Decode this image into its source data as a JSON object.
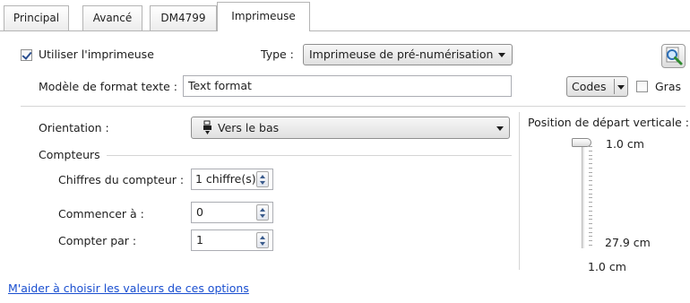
{
  "tabs": [
    {
      "label": "Principal",
      "active": false
    },
    {
      "label": "Avancé",
      "active": false
    },
    {
      "label": "DM4799",
      "active": false
    },
    {
      "label": "Imprimeuse",
      "active": true
    }
  ],
  "imprinter": {
    "use_label": "Utiliser l'imprimeuse",
    "use_checked": true,
    "type_label": "Type :",
    "type_value": "Imprimeuse de pré-numérisation"
  },
  "format": {
    "label": "Modèle de format texte :",
    "value": "Text format",
    "codes_label": "Codes",
    "bold_label": "Gras",
    "bold_checked": false
  },
  "orientation": {
    "label": "Orientation :",
    "value": "Vers le bas"
  },
  "counters": {
    "group_label": "Compteurs",
    "digits_label": "Chiffres du compteur :",
    "digits_value": "1 chiffre(s)",
    "start_label": "Commencer à :",
    "start_value": "0",
    "step_label": "Compter par :",
    "step_value": "1"
  },
  "vertical_position": {
    "label": "Position de départ verticale :",
    "top_value": "1.0 cm",
    "bottom_value": "27.9 cm",
    "current_value": "1.0 cm",
    "slider_fraction": 0
  },
  "help_link": "M'aider à choisir les valeurs de ces options",
  "colors": {
    "link": "#1a4fd0",
    "checkbox_check": "#2a4e8f",
    "spin_arrow": "#3a5b8c"
  },
  "icons": {
    "preview_button": "magnifier-icon",
    "orientation": "printer-down-icon"
  }
}
